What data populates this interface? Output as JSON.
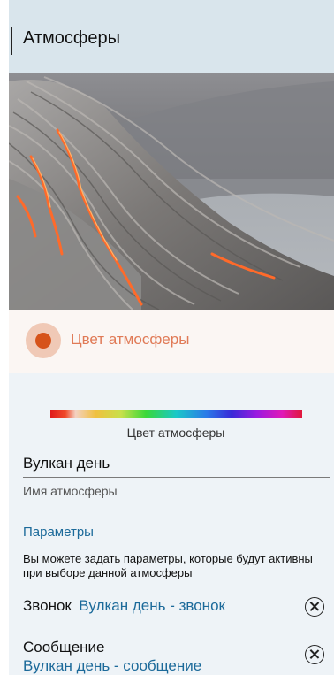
{
  "header": {
    "title": "Атмосферы"
  },
  "hero": {
    "image_name": "volcano-lava-image"
  },
  "color_selector": {
    "label": "Цвет атмосферы",
    "selected_color": "#d6531a"
  },
  "color_spectrum": {
    "label": "Цвет атмосферы"
  },
  "name_field": {
    "value": "Вулкан день",
    "hint": "Имя атмосферы"
  },
  "parameters": {
    "title": "Параметры",
    "description": "Вы можете задать параметры, которые будут активны при выборе данной атмосферы",
    "items": [
      {
        "label": "Звонок",
        "value": "Вулкан день - звонок",
        "remove_icon": "close-circle-icon"
      },
      {
        "label": "Сообщение",
        "value": "Вулкан день - сообщение",
        "remove_icon": "close-circle-icon"
      }
    ]
  },
  "colors": {
    "accent": "#1c6a9a",
    "color_label": "#e07a56",
    "header_bg": "#d9e5ec"
  }
}
